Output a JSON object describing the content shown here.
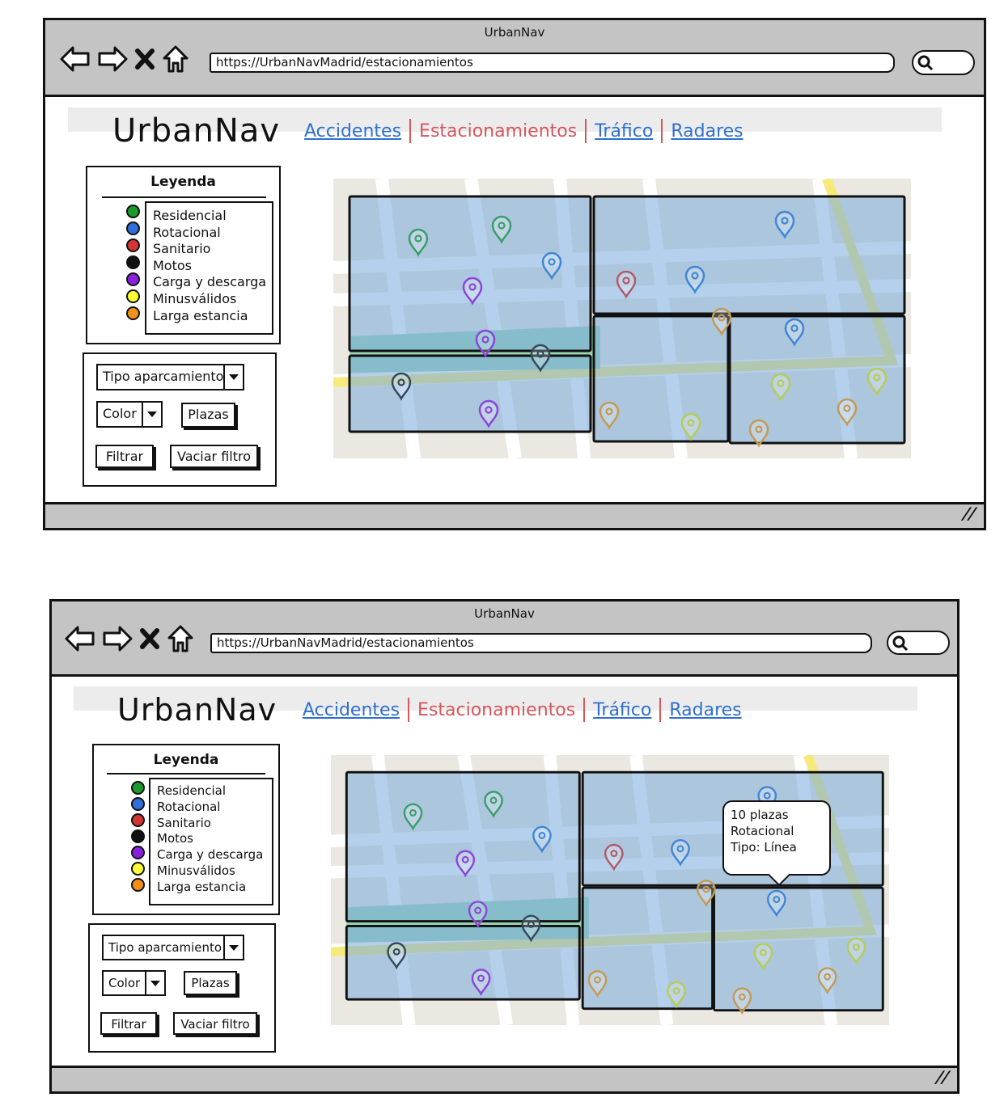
{
  "window_title": "UrbanNav",
  "address_bar": {
    "url": "https://UrbanNavMadrid/estacionamientos"
  },
  "logo": "UrbanNav",
  "nav": [
    "Accidentes",
    "Estacionamientos",
    "Tráfico",
    "Radares"
  ],
  "active_nav": "Estacionamientos",
  "legend": {
    "title": "Leyenda",
    "items": [
      {
        "label": "Residencial",
        "color": "#1a9a2c"
      },
      {
        "label": "Rotacional",
        "color": "#2e6fdc"
      },
      {
        "label": "Sanitario",
        "color": "#d33434"
      },
      {
        "label": "Motos",
        "color": "#111111"
      },
      {
        "label": "Carga y descarga",
        "color": "#8b1fe0"
      },
      {
        "label": "Minusválidos",
        "color": "#ffff33"
      },
      {
        "label": "Larga estancia",
        "color": "#f39018"
      }
    ]
  },
  "filters": {
    "tipo_select": "Tipo aparcamiento",
    "color_select": "Color",
    "plazas_button": "Plazas",
    "filtrar_button": "Filtrar",
    "vaciar_button": "Vaciar filtro"
  },
  "tooltip": {
    "line1": "10 plazas",
    "line2": "Rotacional",
    "line3": "Tipo: Línea"
  }
}
